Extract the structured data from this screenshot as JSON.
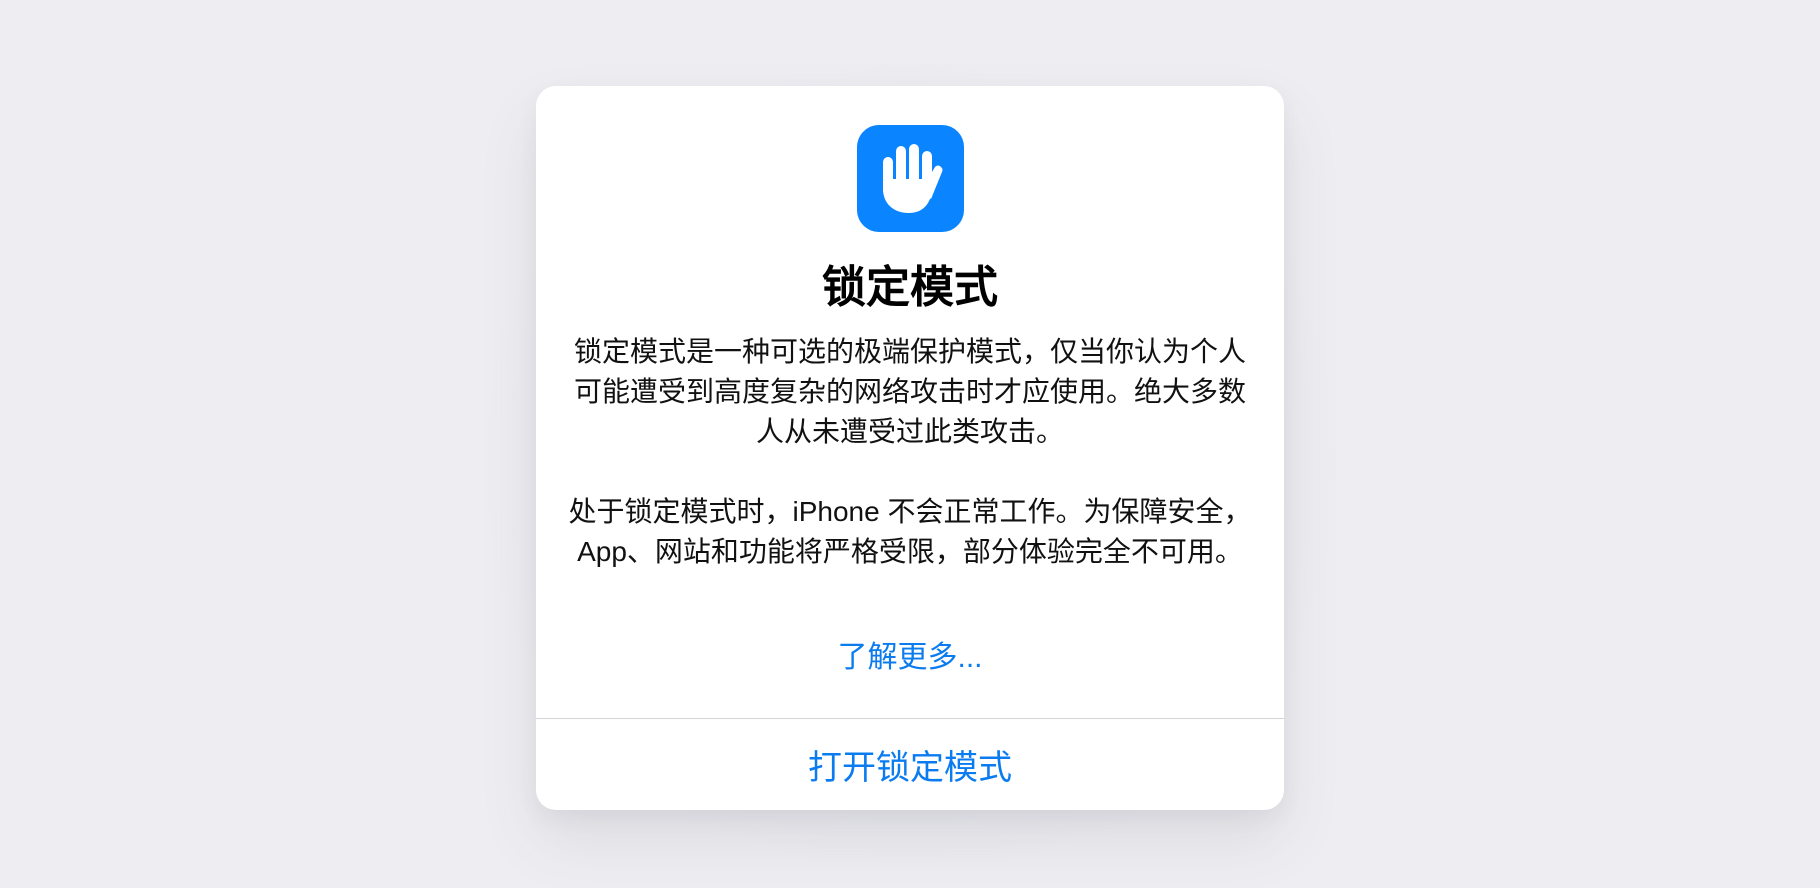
{
  "dialog": {
    "icon": "raised-hand-icon",
    "title": "锁定模式",
    "paragraph1": "锁定模式是一种可选的极端保护模式，仅当你认为个人可能遭受到高度复杂的网络攻击时才应使用。绝大多数人从未遭受过此类攻击。",
    "paragraph2": "处于锁定模式时，iPhone 不会正常工作。为保障安全，App、网站和功能将严格受限，部分体验完全不可用。",
    "learn_more_label": "了解更多...",
    "action_label": "打开锁定模式"
  },
  "colors": {
    "accent": "#0A84FF",
    "link": "#0A7CF0",
    "background": "#EEEEF2",
    "card": "#FFFFFF"
  }
}
